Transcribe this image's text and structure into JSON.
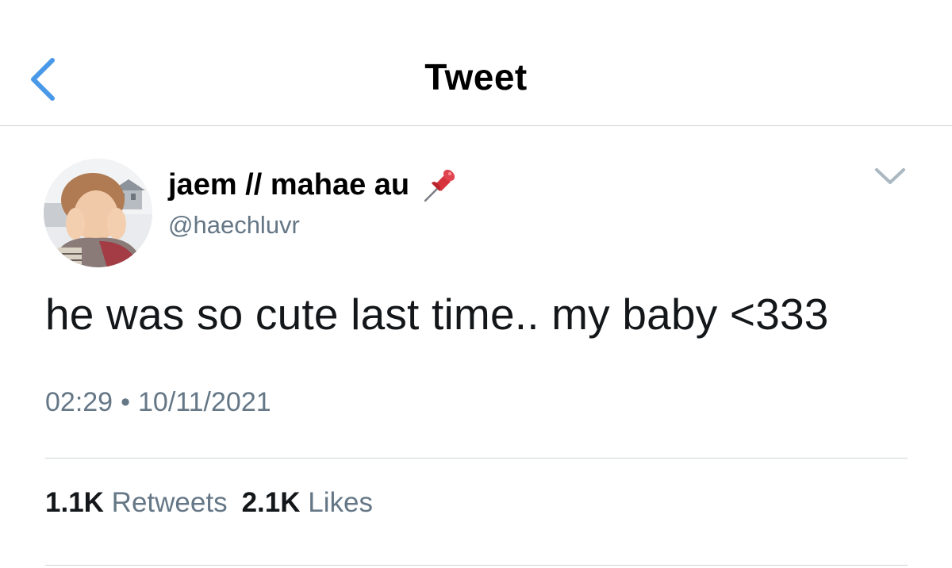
{
  "header": {
    "title": "Tweet",
    "back_icon": "chevron-left-icon",
    "accent_color": "#4a99e9"
  },
  "tweet": {
    "author": {
      "display_name": "jaem // mahae au",
      "name_emoji_icon": "pushpin-icon",
      "handle": "@haechluvr"
    },
    "text": "he was so cute last time.. my baby <333",
    "time": "02:29",
    "separator": "•",
    "date": "10/11/2021",
    "menu_icon": "chevron-down-icon",
    "stats": {
      "retweets_count": "1.1K",
      "retweets_label": "Retweets",
      "likes_count": "2.1K",
      "likes_label": "Likes"
    }
  }
}
